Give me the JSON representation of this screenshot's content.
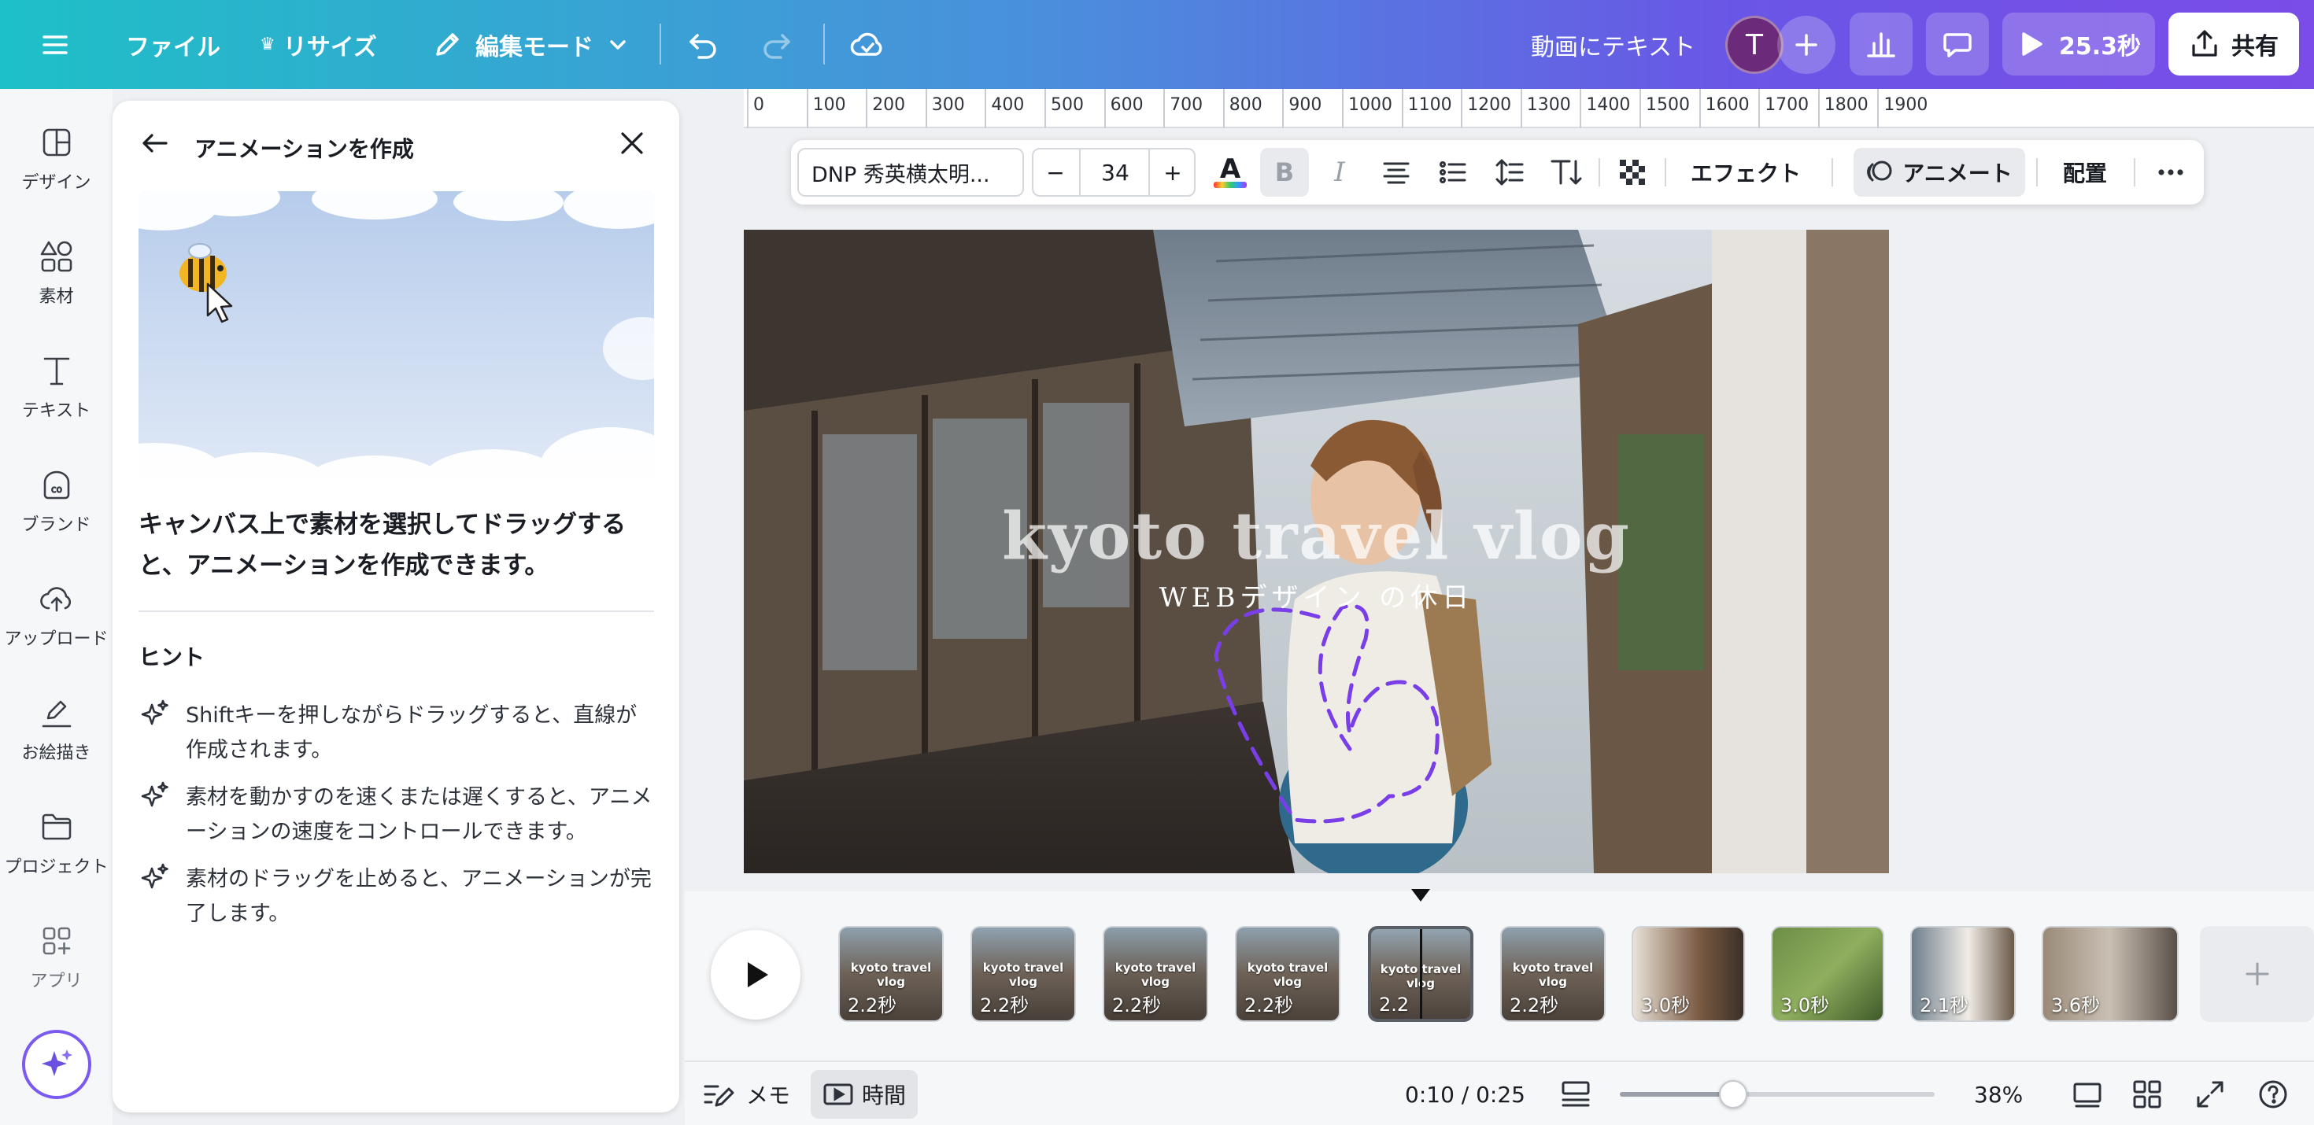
{
  "header": {
    "menu_icon": "hamburger-menu-icon",
    "file_label": "ファイル",
    "resize_label": "リサイズ",
    "resize_icon": "crown-icon",
    "edit_mode_label": "編集モード",
    "edit_icon": "pencil-icon",
    "undo_icon": "undo-icon",
    "redo_icon": "redo-icon",
    "cloud_icon": "cloud-check-icon",
    "doc_title": "動画にテキスト",
    "avatar_letter": "T",
    "add_icon": "plus-icon",
    "insights_icon": "bar-chart-icon",
    "comment_icon": "comment-icon",
    "play_duration": "25.3秒",
    "share_label": "共有",
    "share_icon": "upload-icon",
    "colors": {
      "gradient_start": "#1ec0c7",
      "gradient_end": "#7a4ce8",
      "avatar_bg": "#6b2a7a"
    }
  },
  "sidebar": {
    "items": [
      {
        "label": "デザイン",
        "icon": "design-layout-icon"
      },
      {
        "label": "素材",
        "icon": "elements-shapes-icon"
      },
      {
        "label": "テキスト",
        "icon": "text-t-icon"
      },
      {
        "label": "ブランド",
        "icon": "brand-icon"
      },
      {
        "label": "アップロード",
        "icon": "cloud-upload-icon"
      },
      {
        "label": "お絵描き",
        "icon": "draw-pen-icon"
      },
      {
        "label": "プロジェクト",
        "icon": "folder-icon"
      },
      {
        "label": "アプリ",
        "icon": "apps-grid-icon"
      }
    ],
    "magic_icon": "magic-sparkle-icon"
  },
  "panel": {
    "title": "アニメーションを作成",
    "back_icon": "arrow-left-icon",
    "close_icon": "close-icon",
    "description": "キャンバス上で素材を選択してドラッグすると、アニメーションを作成できます。",
    "hint_title": "ヒント",
    "hints": [
      "Shiftキーを押しながらドラッグすると、直線が作成されます。",
      "素材を動かすのを速くまたは遅くすると、アニメーションの速度をコントロールできます。",
      "素材のドラッグを止めると、アニメーションが完了します。"
    ],
    "hint_icon": "sparkle-icon"
  },
  "ruler": {
    "ticks": [
      "0",
      "100",
      "200",
      "300",
      "400",
      "500",
      "600",
      "700",
      "800",
      "900",
      "1000",
      "1100",
      "1200",
      "1300",
      "1400",
      "1500",
      "1600",
      "1700",
      "1800",
      "1900"
    ]
  },
  "text_toolbar": {
    "font_name": "DNP 秀英横太明...",
    "minus": "−",
    "font_size": "34",
    "plus": "+",
    "text_color_icon": "text-color-a-icon",
    "bold_icon": "bold-b-icon",
    "italic_icon": "italic-i-icon",
    "align_icon": "align-center-icon",
    "list_icon": "bullet-list-icon",
    "spacing_icon": "line-spacing-icon",
    "vertical_text_icon": "vertical-text-icon",
    "transparency_icon": "transparency-checker-icon",
    "effects_label": "エフェクト",
    "animate_label": "アニメート",
    "position_label": "配置",
    "more_icon": "more-dots-icon"
  },
  "canvas": {
    "title_text": "kyoto travel vlog",
    "subtitle_text": "WEBデザイン の休日"
  },
  "timeline": {
    "play_icon": "play-icon",
    "clips": [
      {
        "duration": "2.2秒",
        "caption": "kyoto travel vlog"
      },
      {
        "duration": "2.2秒",
        "caption": "kyoto travel vlog"
      },
      {
        "duration": "2.2秒",
        "caption": "kyoto travel vlog"
      },
      {
        "duration": "2.2秒",
        "caption": "kyoto travel vlog"
      },
      {
        "duration": "2.2",
        "caption": "kyoto travel vlog"
      },
      {
        "duration": "2.2秒",
        "caption": "kyoto travel vlog"
      },
      {
        "duration": "3.0秒",
        "caption": ""
      },
      {
        "duration": "3.0秒",
        "caption": ""
      },
      {
        "duration": "2.1秒",
        "caption": ""
      },
      {
        "duration": "3.6秒",
        "caption": ""
      }
    ],
    "add_icon": "plus-icon"
  },
  "bottom": {
    "notes_label": "メモ",
    "notes_icon": "notes-pen-icon",
    "time_label": "時間",
    "time_icon": "timeline-play-icon",
    "timecode": "0:10 / 0:25",
    "layout_icon": "page-layout-icon",
    "zoom_value": 0.36,
    "zoom_label": "38%",
    "pages_icon": "pages-icon",
    "grid_icon": "grid-view-icon",
    "fullscreen_icon": "fullscreen-icon",
    "help_icon": "help-icon"
  }
}
